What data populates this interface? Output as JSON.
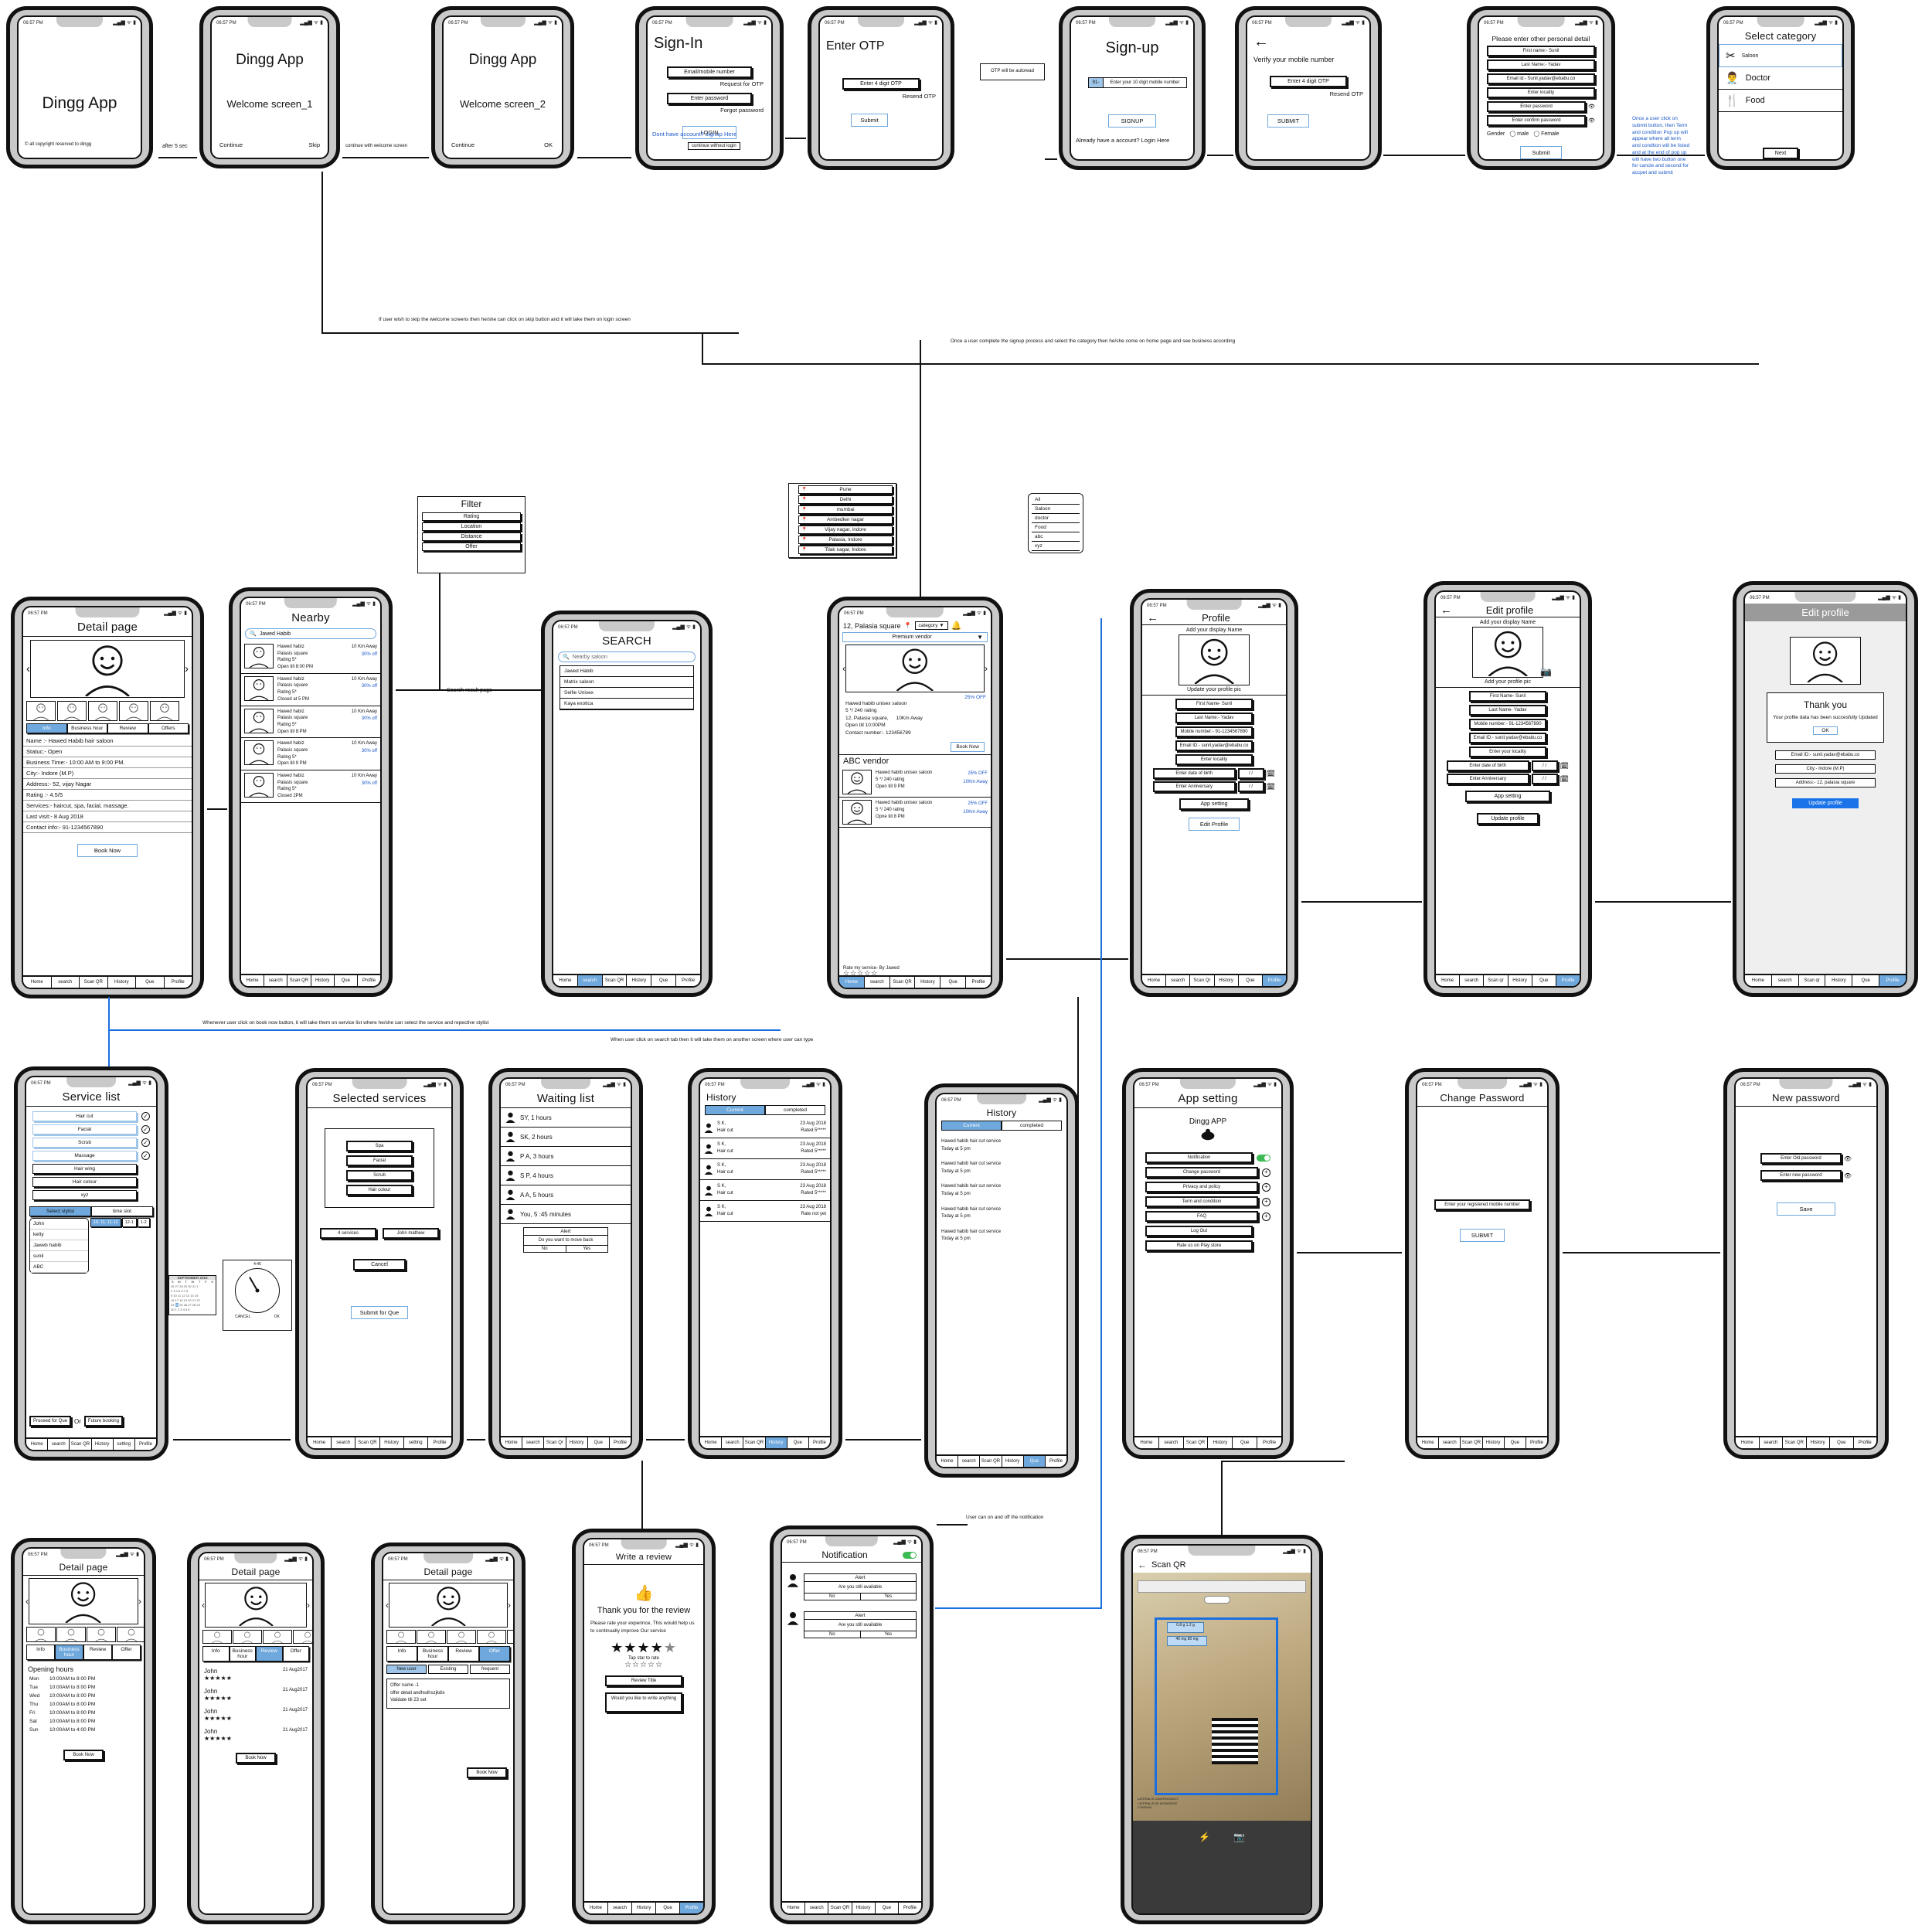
{
  "status_bar": {
    "time": "06:57 PM",
    "icons": "signal-wifi-battery"
  },
  "flow_notes": [
    "after 5 sec",
    "continue with welcome screen",
    "If user wish to skip the welcome screens then he/she can click on skip button and it will take them on login screen",
    "Once a user complete the signup process and select the category then he/she come on home page and see business according",
    "Once a user click on submit button, then Term and condition Pop up will appear where all term and condtion will be listed and at the end of pop up will have two button one for cancle and second for accpet and submit",
    "Search result page",
    "Whenever user click on book now button, it will take them on service list where he/she can select the service and repective stylist",
    "When user click on search tab then it will take them on another screen where user can type",
    "User can on and off the notification"
  ],
  "screens": {
    "splash": {
      "title": "Dingg App",
      "footer": "© all copyright reserved to dingg"
    },
    "welcome1": {
      "brand": "Dingg App",
      "title": "Welcome screen_1",
      "continue": "Continue",
      "skip": "Skip"
    },
    "welcome2": {
      "brand": "Dingg App",
      "title": "Welcome screen_2",
      "continue": "Continue",
      "ok": "OK"
    },
    "signin": {
      "title": "Sign-In",
      "email_placeholder": "Email/mobile number",
      "request_otp": "Request for OTP",
      "password_placeholder": "Enter password",
      "forgot": "Forgot password",
      "login": "LOGIN",
      "signup_link": "Dont have account? signup Here",
      "continue_without": "continue without login"
    },
    "enter_otp": {
      "title": "Enter OTP",
      "otp_placeholder": "Enter 4 digit OTP",
      "resend": "Resend OTP",
      "submit": "Submit",
      "callout": "OTP will be autoread"
    },
    "signup": {
      "title": "Sign-up",
      "country_code": "91-",
      "mobile_placeholder": "Enter your 10 digit mobile number",
      "signup_btn": "SIGNUP",
      "login_link": "Already have a account? Login Here"
    },
    "verify_mobile": {
      "title": "Verify your mobile number",
      "otp_placeholder": "Enter 4 digit OTP",
      "resend": "Resend OTP",
      "submit": "SUBMIT"
    },
    "personal_detail": {
      "title": "Please enter other personal detail",
      "fields": [
        "First name:- Sunil",
        "Last Name:- Yadav",
        "Email id:- Sunil.yadav@ebabu.co",
        "Enter locality",
        "Enter password",
        "Enter confirm password"
      ],
      "gender_label": "Gender",
      "gender_options": [
        "male",
        "Female"
      ],
      "submit": "Submit"
    },
    "select_category": {
      "title": "Select category",
      "items": [
        {
          "label": "Saloon",
          "icon": "scissors-icon",
          "selected": true
        },
        {
          "label": "Doctor",
          "icon": "doctor-icon",
          "selected": false
        },
        {
          "label": "Food",
          "icon": "cutlery-icon",
          "selected": false
        }
      ],
      "next": "Next"
    },
    "detail_page": {
      "title": "Detail page",
      "tabs": [
        "Info",
        "Business hour",
        "Review",
        "Offers"
      ],
      "selected_tab": "Info",
      "info": [
        "Name :- Hawed Habib hair saloon",
        "Statuc:- Open",
        "Business Time:- 10:00 AM to 9:00 PM.",
        "City:- Indore (M.P)",
        "Address:- 52, vijay Nagar",
        "Rating :- 4.5/5",
        "Services:- haircut, spa, facial, massage.",
        "Last visit:- 8 Aug 2018",
        "Contact info:- 91-1234567890"
      ],
      "book_now": "Book Now",
      "nav": [
        "Home",
        "search",
        "Scan QR",
        "History",
        "Que",
        "Profile"
      ]
    },
    "nearby": {
      "title": "Nearby",
      "search_value": "Jawed Habib",
      "items": [
        {
          "name": "Hawed habiz",
          "place": "Palasis square",
          "rating": "Rating 5*",
          "hours": "Open till 8:00 PM",
          "distance": "10 Km Away",
          "off": "30% off"
        },
        {
          "name": "Hawed habiz",
          "place": "Palasis square",
          "rating": "Rating 5*",
          "hours": "Closed at 5 PM",
          "distance": "10 Km Away",
          "off": "30% off"
        },
        {
          "name": "Hawed habiz",
          "place": "Palasis square",
          "rating": "Rating 5*",
          "hours": "Open till 8:PM",
          "distance": "10 Km Away",
          "off": "30% off"
        },
        {
          "name": "Hawed habiz",
          "place": "Palasis square",
          "rating": "Rating 5*",
          "hours": "Open till 9 PM",
          "distance": "10 Km Away",
          "off": "30% off"
        },
        {
          "name": "Hawed habiz",
          "place": "Palasis square",
          "rating": "Rating 5*",
          "hours": "Closed 2PM",
          "distance": "10 Km Away",
          "off": "30% off"
        }
      ],
      "nav": [
        "Home",
        "search",
        "Scan QR",
        "History",
        "Que",
        "Profile"
      ]
    },
    "filter": {
      "title": "Filter",
      "options": [
        "Rating",
        "Location",
        "Distance",
        "Offer"
      ]
    },
    "search": {
      "title": "SEARCH",
      "placeholder": "Nearby saloon",
      "suggestions": [
        "Jawed Habib",
        "Matrix saloon",
        "Selfie Unisex",
        "Kaya exotica"
      ],
      "nav": [
        "Home",
        "search",
        "Scan QR",
        "History",
        "Que",
        "Profile"
      ],
      "active_nav": "search"
    },
    "home_vendor": {
      "location": "12, Palasia square",
      "category_select": "category",
      "premium_banner": "Premium vendor",
      "featured": {
        "name": "Hawed habib unisex saloon",
        "rating": "5 */ 240 rating",
        "address": "12, Palasia square,",
        "distance": "10Km Away",
        "hours": "Open till 10:00PM",
        "contact": "Contact number:- 123456789",
        "off": "25% OFF",
        "book_now": "Book Now"
      },
      "abc_heading": "ABC vendor",
      "abc_items": [
        {
          "name": "Hawed habib unisex saloon",
          "rating": "5 */ 240 rating",
          "hours": "Open till 9 PM",
          "off": "25% OFF",
          "distance": "10Km Away"
        },
        {
          "name": "Hawed habib unisex saloon",
          "rating": "5 */ 240 rating",
          "hours": "Opne till 8 PM",
          "off": "25% OFF",
          "distance": "10Km Away"
        }
      ],
      "rate_line": "Rate my service- By Jawed",
      "nav": [
        "Home",
        "search",
        "Scan QR",
        "History",
        "Que",
        "Profile"
      ],
      "active_nav": "Home"
    },
    "city_dropdown": {
      "items": [
        "Pune",
        "Delhi",
        "mumbai",
        "Ambedker nagar",
        "Vijay nagar, indore",
        "Palasia, Indore",
        "Tilak nagar, Indore"
      ]
    },
    "category_dropdown": {
      "items": [
        "All",
        "Saloon",
        "doctor",
        "Food",
        "abc",
        "xyz"
      ]
    },
    "profile": {
      "title": "Profile",
      "display_name_label": "Add your display Name",
      "update_pic_label": "Update your profile pic",
      "fields": [
        "First Name-  Sunil",
        "Last Name:- Yadav",
        "Mobile number:- 91-1234567890",
        "Email ID:- sunil.yadav@ebabu.co",
        "Enter locality"
      ],
      "dob_label": "Enter date of birth",
      "anniversary_label": "Enter Anniversary",
      "date_placeholder": "/  /",
      "app_setting": "App setting",
      "edit_profile": "Edit Profile",
      "nav": [
        "Home",
        "search",
        "Scan Qr",
        "History",
        "Que",
        "Profile"
      ],
      "active_nav": "Profile"
    },
    "edit_profile": {
      "title": "Edit profile",
      "display_name_label": "Add your display Name",
      "add_pic_label": "Add your profile pic",
      "fields": [
        "First Name- Sunil",
        "Last Name- Yadav",
        "Mobile number:- 91-1234567890",
        "Email ID:- sunil.yadav@ebabu.co",
        "Enter your locality"
      ],
      "dob_label": "Enter date of birth",
      "anniversary_label": "Enter Anniversary",
      "date_placeholder": "/  /",
      "app_setting": "App setting",
      "update_profile": "Update profile",
      "nav": [
        "Home",
        "search",
        "Scan qr",
        "History",
        "Que",
        "Profile"
      ],
      "active_nav": "Profile"
    },
    "edit_profile_thankyou": {
      "title": "Edit profile",
      "dialog_title": "Thank you",
      "dialog_body": "Your profile data has been succesfully Updated",
      "dialog_ok": "OK",
      "fields": [
        "Email ID:- sunil.yadav@ebabu.co",
        "City:- Indore (M.P)",
        "Address:- 12, palasia square"
      ],
      "update_profile": "Update profile",
      "nav": [
        "Home",
        "search",
        "Scan qr",
        "History",
        "Que",
        "Profile"
      ],
      "active_nav": "Profile"
    },
    "service_list": {
      "title": "Service list",
      "services": [
        {
          "label": "Hair cut",
          "checked": true
        },
        {
          "label": "Facial",
          "checked": true
        },
        {
          "label": "Scrub",
          "checked": true
        },
        {
          "label": "Massage",
          "checked": true
        },
        {
          "label": "Hair wing",
          "checked": false
        },
        {
          "label": "Hair colour",
          "checked": false
        },
        {
          "label": "xyz",
          "checked": false
        }
      ],
      "tab_stylist": "Select stylist",
      "tab_timeslot": "time slot",
      "stylists": [
        "John",
        "ketty",
        "Jaweb habib",
        "sunil",
        "ABC"
      ],
      "slots": [
        "10- 11. 11-12",
        "12-1",
        "1-2"
      ],
      "calendar_month": "SEPTEMBER 2018",
      "calendar_days": [
        "S",
        "M",
        "T",
        "W",
        "T",
        "F",
        "S"
      ],
      "clock_cancel": "CANCEL",
      "clock_ok": "OK",
      "proceed": "Proceed for Que",
      "or": "Or",
      "future": "Future booking",
      "nav": [
        "Home",
        "search",
        "Scan QR",
        "History",
        "setting",
        "Profile"
      ]
    },
    "selected_services": {
      "title": "Selected services",
      "services": [
        "Spa",
        "Facial",
        "Scrub",
        "Hair colour"
      ],
      "count": "4 services",
      "stylist": "John mathew",
      "cancel": "Cancel",
      "submit": "Submit for Que",
      "nav": [
        "Home",
        "search",
        "Scan QR",
        "History",
        "setting",
        "Profile"
      ]
    },
    "waiting_list": {
      "title": "Waiting list",
      "rows": [
        "SY, 1 hours",
        "SK, 2 hours",
        "P A, 3 hours",
        "S P, 4 hours",
        "A A, 5 hours",
        "You, 5 :45 minutes"
      ],
      "alert_title": "Alert",
      "alert_body": "Do you want to move back",
      "alert_no": "No",
      "alert_yes": "Yes",
      "nav": [
        "Home",
        "search",
        "Scan Qr",
        "History",
        "Que",
        "Profile"
      ]
    },
    "history_rated": {
      "title": "History",
      "tabs": [
        "Current",
        "completed"
      ],
      "selected_tab": "completed",
      "rows": [
        {
          "name": "S K,",
          "service": "Hair cut",
          "date": "23 Aug 2018",
          "rating": "Rated 5*****"
        },
        {
          "name": "S K,",
          "service": "Hair cut",
          "date": "23 Aug 2018",
          "rating": "Rated 5*****"
        },
        {
          "name": "S K,",
          "service": "Hair cut",
          "date": "23 Aug 2018",
          "rating": "Rated 5*****"
        },
        {
          "name": "S K,",
          "service": "Hair cut",
          "date": "23 Aug 2018",
          "rating": "Rated 5*****"
        },
        {
          "name": "S K,",
          "service": "Hair cut",
          "date": "23 Aug 2018",
          "rating": "Rate not yet"
        }
      ],
      "nav": [
        "Home",
        "search",
        "Scan QR",
        "History",
        "Que",
        "Profile"
      ],
      "active_nav": "History"
    },
    "history_current": {
      "title": "History",
      "tabs": [
        "Current",
        "completed"
      ],
      "selected_tab": "Current",
      "rows": [
        {
          "line1": "Hawed habib hair cut service",
          "line2": "Today at 5 pm"
        },
        {
          "line1": "Hawed habib hair cut service",
          "line2": "Today at 5 pm"
        },
        {
          "line1": "Hawed habib hair cut service",
          "line2": "Today at 5 pm"
        },
        {
          "line1": "Hawed habib hair cut service",
          "line2": "Today at 5 pm"
        },
        {
          "line1": "Hawed habib hair cut service",
          "line2": "Today at 5 pm"
        }
      ],
      "nav": [
        "Home",
        "search",
        "Scan QR",
        "History",
        "Que",
        "Profile"
      ],
      "active_nav": "Que"
    },
    "app_setting": {
      "title": "App setting",
      "brand": "Dingg APP",
      "rows": [
        {
          "label": "Notification",
          "control": "toggle"
        },
        {
          "label": "Change password",
          "control": "plus"
        },
        {
          "label": "Privacy and policy",
          "control": "plus"
        },
        {
          "label": "Term and condition",
          "control": "plus"
        },
        {
          "label": "FAQ",
          "control": "plus"
        },
        {
          "label": "Log Out",
          "control": "none"
        },
        {
          "label": "Rate us on Play store",
          "control": "none"
        }
      ],
      "nav": [
        "Home",
        "search",
        "Scan QR",
        "History",
        "Que",
        "Profile"
      ]
    },
    "change_password": {
      "title": "Change Password",
      "mobile_placeholder": "Enter your registered mobile number",
      "submit": "SUBMIT",
      "nav": [
        "Home",
        "search",
        "Scan QR",
        "History",
        "Que",
        "Profile"
      ]
    },
    "new_password": {
      "title": "New password",
      "old_placeholder": "Enter Old password",
      "new_placeholder": "Enter new password",
      "save": "Save",
      "nav": [
        "Home",
        "search",
        "Scan QR",
        "History",
        "Que",
        "Profile"
      ]
    },
    "detail_hours": {
      "title": "Detail page",
      "tabs": [
        "Info",
        "Business hour",
        "Review",
        "Offer"
      ],
      "selected_tab": "Business hour",
      "heading": "Opening hours",
      "rows": [
        {
          "day": "Mon",
          "hours": "10:00AM to 8:00 PM"
        },
        {
          "day": "Tue",
          "hours": "10:00AM to 8:00 PM"
        },
        {
          "day": "Wed",
          "hours": "10:00AM to 8:00 PM"
        },
        {
          "day": "Thu",
          "hours": "10:00AM to 8:00 PM"
        },
        {
          "day": "Fri",
          "hours": "10:00AM to 8:00 PM"
        },
        {
          "day": "Sat",
          "hours": "10:00AM to 8:00 PM"
        },
        {
          "day": "Sun",
          "hours": "10:00AM to 4:00 PM"
        }
      ],
      "book_now": "Book Now"
    },
    "detail_review": {
      "title": "Detail page",
      "tabs": [
        "Info",
        "Business hour",
        "Review",
        "Offer"
      ],
      "selected_tab": "Review",
      "reviews": [
        {
          "name": "John",
          "date": "21 Aug2017",
          "stars": "★★★★★"
        },
        {
          "name": "John",
          "date": "21 Aug2017",
          "stars": "★★★★★"
        },
        {
          "name": "John",
          "date": "21 Aug2017",
          "stars": "★★★★★"
        },
        {
          "name": "John",
          "date": "21 Aug2017",
          "stars": "★★★★★"
        }
      ],
      "book_now": "Book Now"
    },
    "detail_offer": {
      "title": "Detail page",
      "tabs": [
        "Info",
        "Business hour",
        "Review",
        "Offer"
      ],
      "selected_tab": "Offer",
      "segments": [
        "New user",
        "Existing",
        "frequent"
      ],
      "selected_segment": "New user",
      "offer_name": "Offer name -1",
      "offer_detail": "offer detail andhsdhszjkdix",
      "offer_validity": "Validate till 23 set",
      "book_now": "Book Now"
    },
    "write_review": {
      "title": "Write a review",
      "thanks": "Thank you for the review",
      "body": "Please rate your experince, This would help us to continually improve Our service",
      "rate_label": "Tap star to rate",
      "stars_filled": "★★★★",
      "stars_half": "★",
      "empty_stars": "☆☆☆☆☆",
      "review_title_placeholder": "Review Title",
      "review_body_placeholder": "Would you like to write anything",
      "nav": [
        "Home",
        "search",
        "History",
        "Que",
        "Profile"
      ],
      "active_nav": "Profile"
    },
    "notification": {
      "title": "Notification",
      "toggle_on": true,
      "alerts": [
        {
          "title": "Alert",
          "body": "Are you still available",
          "no": "No",
          "yes": "Yes"
        },
        {
          "title": "Alert",
          "body": "Are you still available",
          "no": "No",
          "yes": "Yes"
        }
      ],
      "nav": [
        "Home",
        "search",
        "Scan QR",
        "History",
        "Que",
        "Profile"
      ]
    },
    "scan_qr": {
      "title": "Scan QR",
      "note": "Scan QR code to pay using Wallet/net",
      "flash_icon": "flash-icon",
      "camera_icon": "camera-icon"
    }
  }
}
